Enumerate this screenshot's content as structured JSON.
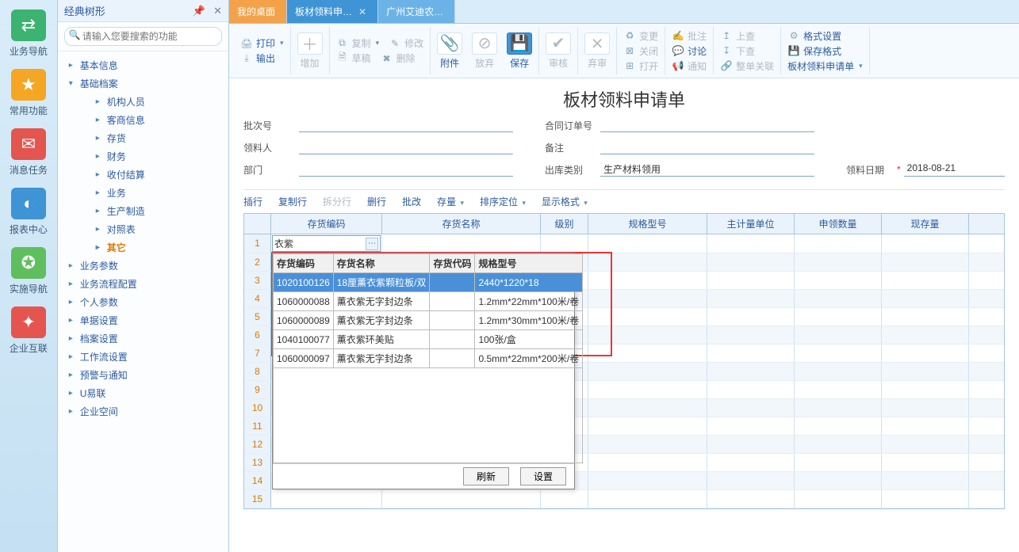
{
  "rail": [
    {
      "label": "业务导航",
      "bg": "#3cb371",
      "glyph": "⇄"
    },
    {
      "label": "常用功能",
      "bg": "#f5a623",
      "glyph": "★"
    },
    {
      "label": "消息任务",
      "bg": "#e4554f",
      "glyph": "✉"
    },
    {
      "label": "报表中心",
      "bg": "#3f94d6",
      "glyph": "◐"
    },
    {
      "label": "实施导航",
      "bg": "#5fbf5f",
      "glyph": "✪"
    },
    {
      "label": "企业互联",
      "bg": "#e4554f",
      "glyph": "✦"
    }
  ],
  "tree": {
    "title": "经典树形",
    "search_ph": "请输入您要搜索的功能",
    "nodes": [
      {
        "label": "基本信息",
        "level": 0,
        "exp": false
      },
      {
        "label": "基础档案",
        "level": 0,
        "exp": true,
        "children": [
          {
            "label": "机构人员"
          },
          {
            "label": "客商信息"
          },
          {
            "label": "存货"
          },
          {
            "label": "财务"
          },
          {
            "label": "收付结算"
          },
          {
            "label": "业务"
          },
          {
            "label": "生产制造"
          },
          {
            "label": "对照表"
          },
          {
            "label": "其它",
            "sel": true
          }
        ]
      },
      {
        "label": "业务参数",
        "level": 0,
        "exp": false
      },
      {
        "label": "业务流程配置",
        "level": 0,
        "exp": false
      },
      {
        "label": "个人参数",
        "level": 0,
        "exp": false
      },
      {
        "label": "单据设置",
        "level": 0,
        "exp": false
      },
      {
        "label": "档案设置",
        "level": 0,
        "exp": false
      },
      {
        "label": "工作流设置",
        "level": 0,
        "exp": false
      },
      {
        "label": "预警与通知",
        "level": 0,
        "exp": false
      },
      {
        "label": "U易联",
        "level": 0,
        "exp": false
      },
      {
        "label": "企业空间",
        "level": 0,
        "exp": false
      }
    ]
  },
  "tabs": [
    {
      "label": "我的桌面",
      "cls": "orange",
      "close": false
    },
    {
      "label": "板材领料申…",
      "cls": "blue",
      "close": true
    },
    {
      "label": "广州艾迪农…",
      "cls": "blue2",
      "close": false
    }
  ],
  "toolbar": {
    "print": "打印",
    "output": "输出",
    "add": "增加",
    "copy": "复制",
    "draft": "草稿",
    "modify": "修改",
    "delete": "删除",
    "attach": "附件",
    "discard": "放弃",
    "save": "保存",
    "audit": "审核",
    "abandon": "弃审",
    "change": "变更",
    "close": "关闭",
    "open": "打开",
    "annotate": "批注",
    "discuss": "讨论",
    "notify": "通知",
    "submit": "上查",
    "revert": "下查",
    "assoc": "整单关联",
    "format": "格式设置",
    "savefmt": "保存格式",
    "docname": "板材领料申请单"
  },
  "doc": {
    "title": "板材领料申请单",
    "batch_label": "批次号",
    "contract_label": "合同订单号",
    "picker_label": "领料人",
    "remark_label": "备注",
    "dept_label": "部门",
    "outtype_label": "出库类别",
    "outtype_value": "生产材料领用",
    "date_label": "领料日期",
    "date_value": "2018-08-21"
  },
  "gridtb": {
    "insert": "插行",
    "copy": "复制行",
    "split": "拆分行",
    "delete": "删行",
    "batch": "批改",
    "stock": "存量",
    "locate": "排序定位",
    "display": "显示格式"
  },
  "cols": {
    "code": "存货编码",
    "name": "存货名称",
    "level": "级别",
    "spec": "规格型号",
    "unit": "主计量单位",
    "req": "申领数量",
    "stock": "现存量"
  },
  "editvalue": "衣紫",
  "popup": {
    "h1": "存货编码",
    "h2": "存货名称",
    "h3": "存货代码",
    "h4": "规格型号",
    "rows": [
      {
        "code": "1020100126",
        "name": "18厘薰衣紫颗粒板/双",
        "proxy": "",
        "spec": "2440*1220*18",
        "sel": true
      },
      {
        "code": "1060000088",
        "name": "薰衣紫无字封边条",
        "proxy": "",
        "spec": "1.2mm*22mm*100米/卷"
      },
      {
        "code": "1060000089",
        "name": "薰衣紫无字封边条",
        "proxy": "",
        "spec": "1.2mm*30mm*100米/卷"
      },
      {
        "code": "1040100077",
        "name": "薰衣紫环美贴",
        "proxy": "",
        "spec": "100张/盒"
      },
      {
        "code": "1060000097",
        "name": "薰衣紫无字封边条",
        "proxy": "",
        "spec": "0.5mm*22mm*200米/卷"
      }
    ],
    "refresh": "刷新",
    "settings": "设置"
  }
}
